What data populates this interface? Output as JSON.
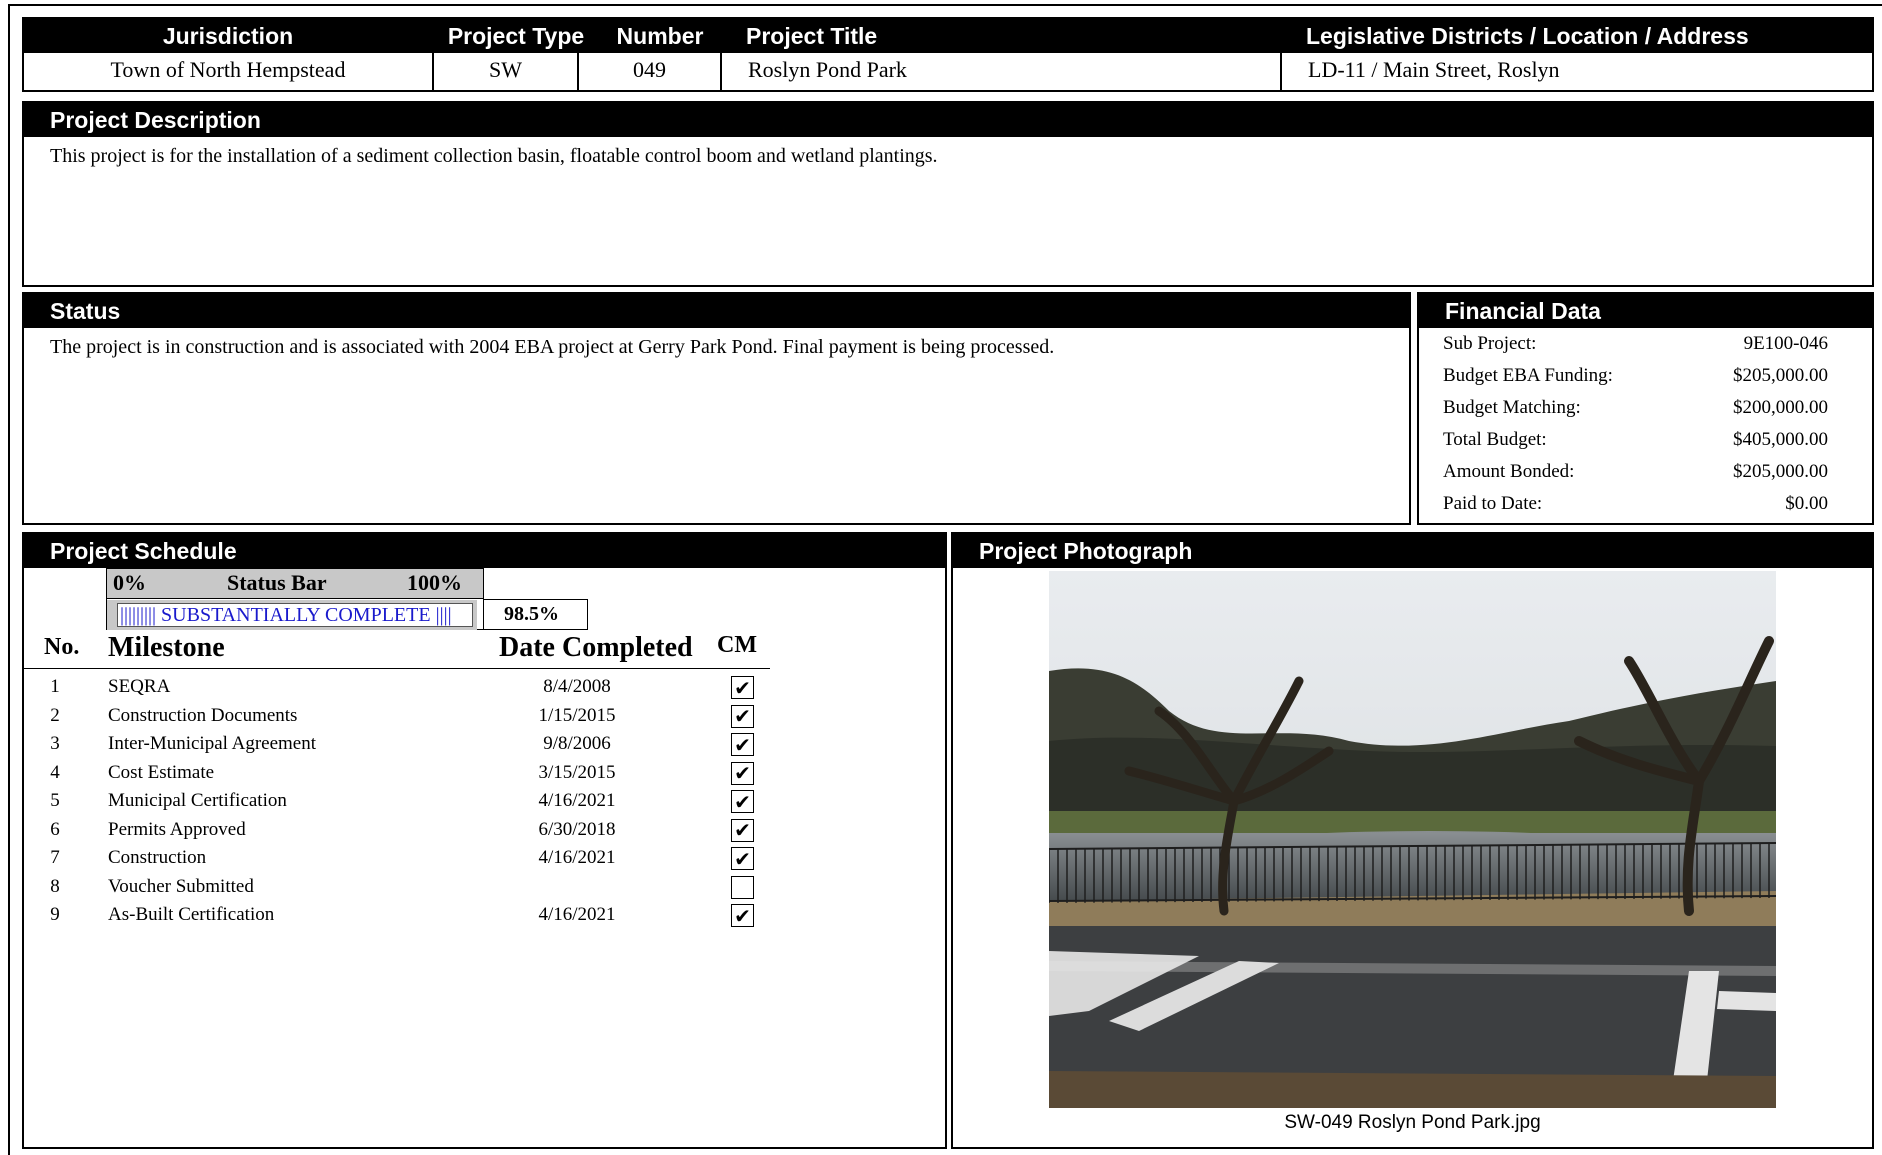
{
  "header": {
    "columns": {
      "jurisdiction": "Jurisdiction",
      "project_type": "Project Type",
      "number": "Number",
      "project_title": "Project Title",
      "location": "Legislative Districts / Location / Address"
    },
    "values": {
      "jurisdiction": "Town of North Hempstead",
      "project_type": "SW",
      "number": "049",
      "project_title": "Roslyn Pond Park",
      "location": "LD-11 / Main Street, Roslyn"
    }
  },
  "description": {
    "title": "Project Description",
    "text": "This project is for the installation of a sediment collection basin, floatable control boom and wetland plantings."
  },
  "status": {
    "title": "Status",
    "text": "The project is in construction and is associated with 2004 EBA project at Gerry Park Pond. Final payment is being processed."
  },
  "financial": {
    "title": "Financial Data",
    "rows": [
      {
        "label": "Sub Project:",
        "value": "9E100-046"
      },
      {
        "label": "Budget EBA Funding:",
        "value": "$205,000.00"
      },
      {
        "label": "Budget Matching:",
        "value": "$200,000.00"
      },
      {
        "label": "Total Budget:",
        "value": "$405,000.00"
      },
      {
        "label": "Amount Bonded:",
        "value": "$205,000.00"
      },
      {
        "label": "Paid to Date:",
        "value": "$0.00"
      }
    ]
  },
  "schedule": {
    "title": "Project Schedule",
    "status_bar": {
      "min_label": "0%",
      "label": "Status Bar",
      "max_label": "100%",
      "fill_text": "||||||||| SUBSTANTIALLY COMPLETE ||||",
      "percent": "98.5%",
      "fraction": 0.985
    },
    "columns": {
      "no": "No.",
      "milestone": "Milestone",
      "date": "Date Completed",
      "cm": "CM"
    },
    "milestones": [
      {
        "no": "1",
        "name": "SEQRA",
        "date": "8/4/2008",
        "cm": true
      },
      {
        "no": "2",
        "name": "Construction Documents",
        "date": "1/15/2015",
        "cm": true
      },
      {
        "no": "3",
        "name": "Inter-Municipal Agreement",
        "date": "9/8/2006",
        "cm": true
      },
      {
        "no": "4",
        "name": "Cost Estimate",
        "date": "3/15/2015",
        "cm": true
      },
      {
        "no": "5",
        "name": "Municipal Certification",
        "date": "4/16/2021",
        "cm": true
      },
      {
        "no": "6",
        "name": "Permits Approved",
        "date": "6/30/2018",
        "cm": true
      },
      {
        "no": "7",
        "name": "Construction",
        "date": "4/16/2021",
        "cm": true
      },
      {
        "no": "8",
        "name": "Voucher Submitted",
        "date": "",
        "cm": false
      },
      {
        "no": "9",
        "name": "As-Built Certification",
        "date": "4/16/2021",
        "cm": true
      }
    ]
  },
  "photo": {
    "title": "Project Photograph",
    "caption": "SW-049 Roslyn Pond Park.jpg"
  },
  "icons": {
    "check": "checkmark-icon"
  }
}
